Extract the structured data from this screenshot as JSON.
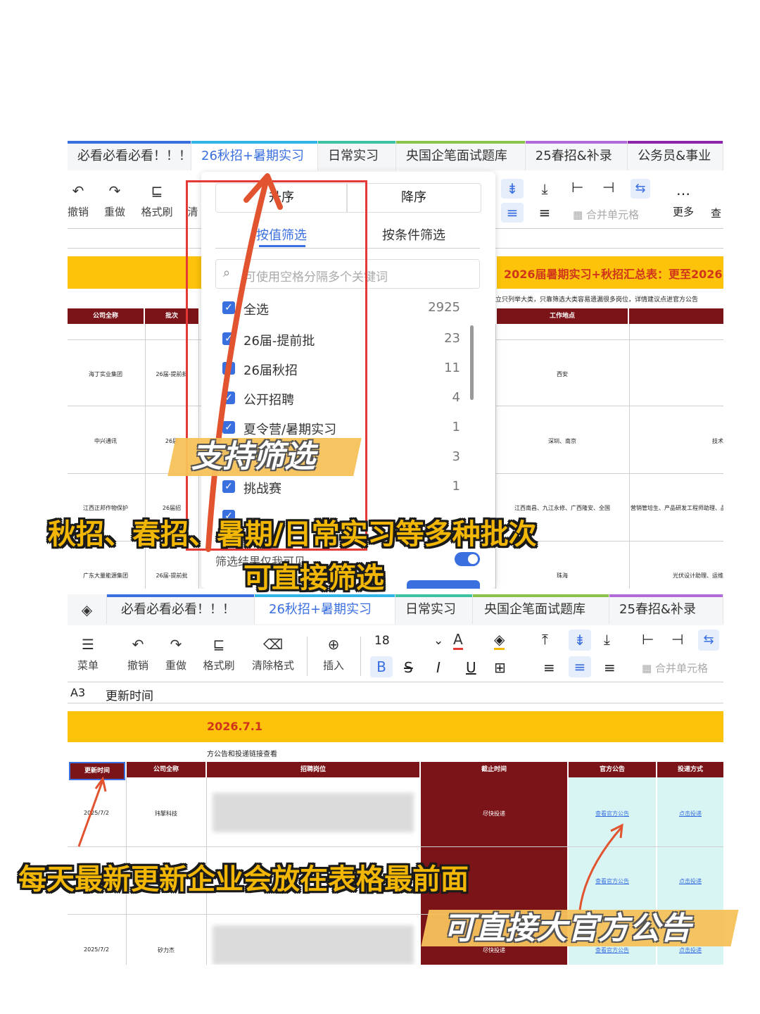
{
  "top": {
    "tabs": [
      {
        "label": "必看必看必看！！！",
        "color": "#3a6fe0"
      },
      {
        "label": "26秋招+暑期实习",
        "color": "#2fb5e6",
        "active": true
      },
      {
        "label": "日常实习",
        "color": "#3ec2a4"
      },
      {
        "label": "央国企笔面试题库",
        "color": "#8bc34a"
      },
      {
        "label": "25春招&补录",
        "color": "#b36ad9"
      },
      {
        "label": "公务员&事业",
        "color": "#8e24aa"
      }
    ],
    "toolbar": [
      {
        "label": "撤销",
        "icon": "undo-icon"
      },
      {
        "label": "重做",
        "icon": "redo-icon"
      },
      {
        "label": "格式刷",
        "icon": "format-painter-icon"
      },
      {
        "label": "清",
        "icon": "clear-icon"
      }
    ],
    "toolbar_right": {
      "merge": "合并单元格",
      "more": "更多",
      "find": "查"
    },
    "sort": {
      "asc": "升序",
      "desc": "降序"
    },
    "filter_tabs": {
      "by_value": "按值筛选",
      "by_condition": "按条件筛选"
    },
    "search_placeholder": "可使用空格分隔多个关键词",
    "options": [
      {
        "label": "全选",
        "count": "2925"
      },
      {
        "label": "26届-提前批",
        "count": "23"
      },
      {
        "label": "26届秋招",
        "count": "11"
      },
      {
        "label": "公开招聘",
        "count": "4"
      },
      {
        "label": "夏令营/暑期实习",
        "count": "1"
      },
      {
        "label": "",
        "count": "3"
      },
      {
        "label": "挑战赛",
        "count": "1"
      }
    ],
    "filter_footer": "筛选结果仅我可见",
    "banner_title": "2026届暑期实习+秋招汇总表：更至2026.",
    "banner_note": "立只列举大类，只靠筛选大类容易遗漏很多岗位，详情建议点进官方公告",
    "headers": {
      "company": "公司全称",
      "batch": "批次",
      "location": "工作地点"
    },
    "rows": [
      {
        "company": "海丁实业集团",
        "batch": "26届-提前批",
        "location": "西安",
        "role": ""
      },
      {
        "company": "中兴通讯",
        "batch": "26届",
        "location": "深圳、南京",
        "role": "技术"
      },
      {
        "company": "江西正邦作物保护",
        "batch": "26届招",
        "location": "江西南昌、九江永修、广西隆安、全国",
        "role": "营销管培生、产品研发工程师助理、品"
      },
      {
        "company": "广东大量能源集团",
        "batch": "26届-提前批",
        "location": "珠海",
        "role": "光伏设计助理、运维"
      }
    ]
  },
  "bottom": {
    "tabs": [
      {
        "label": "必看必看必看！！！",
        "color": "#3a6fe0"
      },
      {
        "label": "26秋招+暑期实习",
        "color": "#2fb5e6",
        "active": true
      },
      {
        "label": "日常实习",
        "color": "#3ec2a4"
      },
      {
        "label": "央国企笔面试题库",
        "color": "#8bc34a"
      },
      {
        "label": "25春招&补录",
        "color": "#b36ad9"
      }
    ],
    "toolbar": [
      {
        "label": "菜单",
        "icon": "menu-icon"
      },
      {
        "label": "撤销",
        "icon": "undo-icon"
      },
      {
        "label": "重做",
        "icon": "redo-icon"
      },
      {
        "label": "格式刷",
        "icon": "format-painter-icon"
      },
      {
        "label": "清除格式",
        "icon": "clear-format-icon"
      },
      {
        "label": "插入",
        "icon": "insert-icon"
      }
    ],
    "font_size": "18",
    "merge": "合并单元格",
    "cell_ref": "A3",
    "cell_value": "更新时间",
    "banner_title": "2026.7.1",
    "banner_note": "方公告和投递链接查看",
    "headers": [
      "更新时间",
      "公司全称",
      "招聘岗位",
      "截止时间",
      "官方公告",
      "投递方式"
    ],
    "rows": [
      {
        "date": "2025/7/2",
        "company": "玮擎科技",
        "deadline": "尽快投递",
        "notice": "查看官方公告",
        "apply": "点击投递"
      },
      {
        "date": "",
        "company": "",
        "deadline": "",
        "notice": "查看官方公告",
        "apply": "点击投递"
      },
      {
        "date": "2025/7/2",
        "company": "矽力杰",
        "deadline": "尽快投递",
        "notice": "查看官方公告",
        "apply": "点击投递"
      }
    ]
  },
  "captions": {
    "filter_stamp": "支持筛选",
    "batches": "秋招、春招、暑期/日常实习等多种批次",
    "direct_filter": "可直接筛选",
    "newest": "每天最新更新企业会放在表格最前面",
    "official": "可直接大官方公告"
  },
  "colors": {
    "accent": "#3a6fe0",
    "header_red": "#7a1418",
    "banner_yellow": "#fcc30a",
    "notice_cyan": "#d8f5f3",
    "caption_yellow": "#f2b705"
  }
}
